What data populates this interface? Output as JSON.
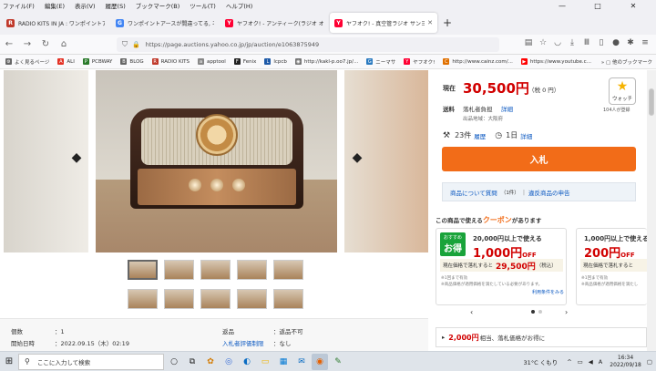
{
  "menu": [
    "ファイル(F)",
    "編集(E)",
    "表示(V)",
    "履歴(S)",
    "ブックマーク(B)",
    "ツール(T)",
    "ヘルプ(H)"
  ],
  "window_controls": [
    "—",
    "□",
    "✕"
  ],
  "tabs": [
    {
      "title": "RADIO KITS IN JA : ワンポイントアース",
      "icon": "radio-kits-icon",
      "color": "#c0392b"
    },
    {
      "title": "ワンポイントアースが間違ってる, ネ",
      "icon": "google-icon",
      "color": "#4285f4"
    },
    {
      "title": "ヤフオク! - アンティーク(ラジオ オーディオ)",
      "icon": "yahoo-icon",
      "color": "#ff0033"
    },
    {
      "title": "ヤフオク! - 真空管ラジオ サンヨー SS",
      "icon": "yahoo-icon",
      "color": "#ff0033",
      "active": true
    }
  ],
  "new_tab": "+",
  "url": "https://page.auctions.yahoo.co.jp/jp/auction/e1063875949",
  "bookmarks": [
    {
      "label": "よく見るページ",
      "icon": "gear-icon",
      "color": "#666"
    },
    {
      "label": "ALI",
      "icon": "ali-icon",
      "color": "#e43225"
    },
    {
      "label": "PCBWAY",
      "icon": "pcbway-icon",
      "color": "#2a7a2a"
    },
    {
      "label": "BLOG",
      "icon": "blog-icon",
      "color": "#666"
    },
    {
      "label": "RADIO KITS",
      "icon": "radio-kits-icon",
      "color": "#c0392b"
    },
    {
      "label": "apptool",
      "icon": "apptool-icon",
      "color": "#888"
    },
    {
      "label": "Fenix",
      "icon": "fenix-icon",
      "color": "#222"
    },
    {
      "label": "lcpcb",
      "icon": "lcpcb-icon",
      "color": "#1e5aa8"
    },
    {
      "label": "http://kakl-p.oo7.jp/...",
      "icon": "globe-icon",
      "color": "#777"
    },
    {
      "label": "ニーマサ",
      "icon": "nimasa-icon",
      "color": "#2a7ac0"
    },
    {
      "label": "ヤフオク!",
      "icon": "yahoo-icon",
      "color": "#ff0033"
    },
    {
      "label": "http://www.cainz.com/...",
      "icon": "cainz-icon",
      "color": "#e07000"
    },
    {
      "label": "https://www.youtube.c...",
      "icon": "youtube-icon",
      "color": "#ff0000"
    }
  ],
  "bookmarks_other": "他のブックマーク",
  "price": {
    "label": "現在",
    "value": "30,500円",
    "tax": "（税 0 円）"
  },
  "watch": {
    "label": "ウォッチ",
    "count": "104人が登録"
  },
  "shipping": {
    "label": "送料",
    "value": "落札者負担",
    "detail_link": "詳細",
    "origin": "出品地域：大阪府"
  },
  "bids": {
    "count": "23件",
    "history_link": "履歴",
    "remaining": "1日",
    "detail_link": "詳細"
  },
  "bid_button": "入札",
  "qa": {
    "question_link": "商品について質問",
    "question_count": "（1件）",
    "separator": "|",
    "report_link": "違反商品の申告"
  },
  "coupon_section": {
    "prefix": "この商品で使える",
    "highlight": "クーポン",
    "suffix": "があります"
  },
  "coupons": [
    {
      "badge_top": "おすすめ",
      "badge_main": "お得",
      "condition": "20,000円以上で使える",
      "discount": "1,000円",
      "off": "OFF",
      "line_prefix": "現在価格で落札すると",
      "line_price": "29,500円",
      "line_suffix": "（税込）",
      "note1": "※1回まで有効",
      "note2": "※商品価格が適用価格を満たしている必要があります。",
      "detail_link": "利用条件をみる"
    },
    {
      "badge_top": "",
      "badge_main": "",
      "condition": "1,000円以上で使える",
      "discount": "200円",
      "off": "OFF",
      "line_prefix": "現在価格で落札すると",
      "line_price": "",
      "line_suffix": "",
      "note1": "※1回まで有効",
      "note2": "※商品価格が適用価格を満たし",
      "detail_link": ""
    }
  ],
  "carousel": {
    "prev": "‹",
    "next": "›"
  },
  "bottom_banner": {
    "amount": "2,000円",
    "text": "相当、落札価格がお得に"
  },
  "specs": {
    "count_label": "個数",
    "count_value": "：1",
    "start_label": "開始日時",
    "start_value": "：2022.09.15（木）02:19",
    "return_label": "返品",
    "return_value": "：返品不可",
    "rating_label": "入札者評価制限",
    "rating_value": "：なし"
  },
  "taskbar": {
    "search_placeholder": "ここに入力して検索",
    "weather": "31°C くもり",
    "ime": "A",
    "time": "16:34",
    "date": "2022/09/18"
  }
}
